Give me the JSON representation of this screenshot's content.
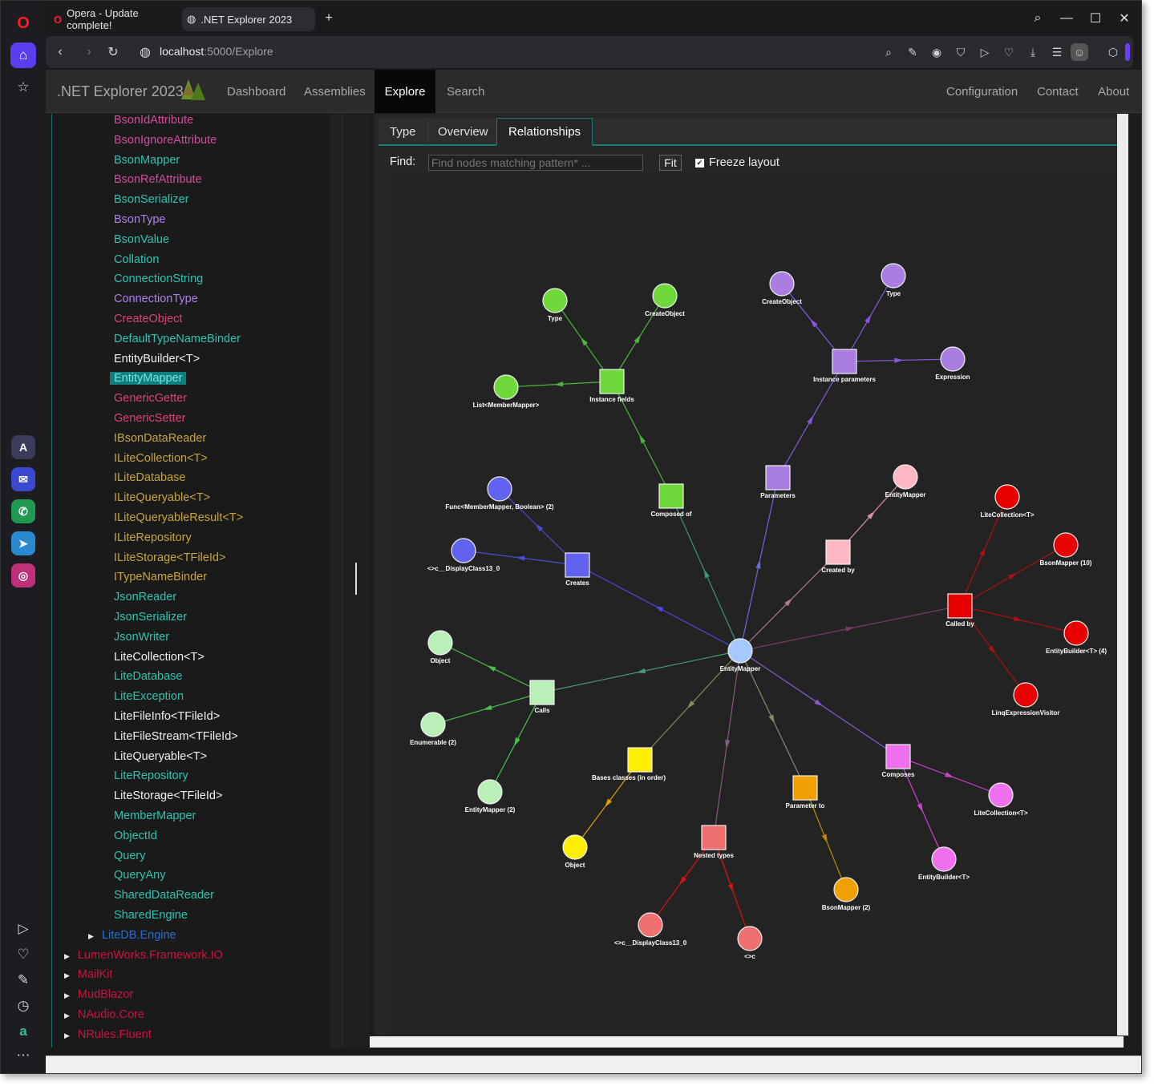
{
  "browser": {
    "tabs": [
      {
        "title": "Opera - Update complete!"
      },
      {
        "title": ".NET Explorer 2023"
      }
    ],
    "url_host": "localhost",
    "url_rest": ":5000/Explore"
  },
  "app": {
    "brand": ".NET Explorer 2023",
    "nav": [
      "Dashboard",
      "Assemblies",
      "Explore",
      "Search"
    ],
    "nav_right": [
      "Configuration",
      "Contact",
      "About"
    ],
    "active_nav": "Explore"
  },
  "tree": {
    "items": [
      {
        "label": "BsonIdAttribute",
        "color": "#d64aa0"
      },
      {
        "label": "BsonIgnoreAttribute",
        "color": "#d64aa0"
      },
      {
        "label": "BsonMapper",
        "color": "#2cc4b0"
      },
      {
        "label": "BsonRefAttribute",
        "color": "#d64aa0"
      },
      {
        "label": "BsonSerializer",
        "color": "#2cc4b0"
      },
      {
        "label": "BsonType",
        "color": "#b07ff0"
      },
      {
        "label": "BsonValue",
        "color": "#2cc4b0"
      },
      {
        "label": "Collation",
        "color": "#2cc4b0"
      },
      {
        "label": "ConnectionString",
        "color": "#2cc4b0"
      },
      {
        "label": "ConnectionType",
        "color": "#b07ff0"
      },
      {
        "label": "CreateObject",
        "color": "#e0407a"
      },
      {
        "label": "DefaultTypeNameBinder",
        "color": "#2cc4b0"
      },
      {
        "label": "EntityBuilder<T>",
        "color": "#f0f0f0"
      },
      {
        "label": "EntityMapper",
        "color": "#7fe0e0"
      },
      {
        "label": "GenericGetter",
        "color": "#e0407a"
      },
      {
        "label": "GenericSetter",
        "color": "#e0407a"
      },
      {
        "label": "IBsonDataReader",
        "color": "#c8a43a"
      },
      {
        "label": "ILiteCollection<T>",
        "color": "#c8a43a"
      },
      {
        "label": "ILiteDatabase",
        "color": "#c8a43a"
      },
      {
        "label": "ILiteQueryable<T>",
        "color": "#c8a43a"
      },
      {
        "label": "ILiteQueryableResult<T>",
        "color": "#c8a43a"
      },
      {
        "label": "ILiteRepository",
        "color": "#c8a43a"
      },
      {
        "label": "ILiteStorage<TFileId>",
        "color": "#c8a43a"
      },
      {
        "label": "ITypeNameBinder",
        "color": "#c8a43a"
      },
      {
        "label": "JsonReader",
        "color": "#2cc4b0"
      },
      {
        "label": "JsonSerializer",
        "color": "#2cc4b0"
      },
      {
        "label": "JsonWriter",
        "color": "#2cc4b0"
      },
      {
        "label": "LiteCollection<T>",
        "color": "#f0f0f0"
      },
      {
        "label": "LiteDatabase",
        "color": "#2cc4b0"
      },
      {
        "label": "LiteException",
        "color": "#2cc4b0"
      },
      {
        "label": "LiteFileInfo<TFileId>",
        "color": "#f0f0f0"
      },
      {
        "label": "LiteFileStream<TFileId>",
        "color": "#f0f0f0"
      },
      {
        "label": "LiteQueryable<T>",
        "color": "#f0f0f0"
      },
      {
        "label": "LiteRepository",
        "color": "#2cc4b0"
      },
      {
        "label": "LiteStorage<TFileId>",
        "color": "#f0f0f0"
      },
      {
        "label": "MemberMapper",
        "color": "#2cc4b0"
      },
      {
        "label": "ObjectId",
        "color": "#2cc4b0"
      },
      {
        "label": "Query",
        "color": "#2cc4b0"
      },
      {
        "label": "QueryAny",
        "color": "#2cc4b0"
      },
      {
        "label": "SharedDataReader",
        "color": "#2cc4b0"
      },
      {
        "label": "SharedEngine",
        "color": "#2cc4b0"
      }
    ],
    "selected": "EntityMapper",
    "namespace": {
      "label": "LiteDB.Engine",
      "color": "#2a6fd0"
    },
    "assemblies": [
      {
        "label": "LumenWorks.Framework.IO",
        "color": "#c8143c"
      },
      {
        "label": "MailKit",
        "color": "#c8143c"
      },
      {
        "label": "MudBlazor",
        "color": "#c8143c"
      },
      {
        "label": "NAudio.Core",
        "color": "#c8143c"
      },
      {
        "label": "NRules.Fluent",
        "color": "#c8143c"
      }
    ]
  },
  "content": {
    "tabs": [
      "Type",
      "Overview",
      "Relationships"
    ],
    "active_tab": "Relationships",
    "find_label": "Find:",
    "find_placeholder": "Find nodes matching pattern* ...",
    "fit_label": "Fit",
    "freeze_label": "Freeze layout",
    "freeze_checked": true
  },
  "graph": {
    "nodes": [
      {
        "id": "center",
        "label": "EntityMapper",
        "shape": "circle",
        "color": "#a4c8ff"
      },
      {
        "id": "composed",
        "label": "Composed of",
        "shape": "square",
        "color": "#6fd83a"
      },
      {
        "id": "instfields",
        "label": "Instance fields",
        "shape": "square",
        "color": "#6fd83a"
      },
      {
        "id": "g_type",
        "label": "Type",
        "shape": "circle",
        "color": "#6fd83a"
      },
      {
        "id": "g_create",
        "label": "CreateObject",
        "shape": "circle",
        "color": "#6fd83a"
      },
      {
        "id": "g_list",
        "label": "List<MemberMapper>",
        "shape": "circle",
        "color": "#6fd83a"
      },
      {
        "id": "params",
        "label": "Parameters",
        "shape": "square",
        "color": "#a97ee0"
      },
      {
        "id": "instparams",
        "label": "Instance parameters",
        "shape": "square",
        "color": "#a97ee0"
      },
      {
        "id": "p_create",
        "label": "CreateObject",
        "shape": "circle",
        "color": "#a97ee0"
      },
      {
        "id": "p_type",
        "label": "Type",
        "shape": "circle",
        "color": "#a97ee0"
      },
      {
        "id": "p_expr",
        "label": "Expression",
        "shape": "circle",
        "color": "#a97ee0"
      },
      {
        "id": "creates",
        "label": "Creates",
        "shape": "square",
        "color": "#6262f0"
      },
      {
        "id": "c_func",
        "label": "Func<MemberMapper, Boolean> (2)",
        "shape": "circle",
        "color": "#6262f0"
      },
      {
        "id": "c_disp",
        "label": "<>c__DisplayClass13_0",
        "shape": "circle",
        "color": "#6262f0"
      },
      {
        "id": "createdby",
        "label": "Created by",
        "shape": "square",
        "color": "#ffb8c4"
      },
      {
        "id": "cb_em",
        "label": "EntityMapper",
        "shape": "circle",
        "color": "#ffb8c4"
      },
      {
        "id": "calledby",
        "label": "Called by",
        "shape": "square",
        "color": "#e80000"
      },
      {
        "id": "r_lc",
        "label": "LiteCollection<T>",
        "shape": "circle",
        "color": "#e80000"
      },
      {
        "id": "r_bm",
        "label": "BsonMapper (10)",
        "shape": "circle",
        "color": "#e80000"
      },
      {
        "id": "r_eb",
        "label": "EntityBuilder<T> (4)",
        "shape": "circle",
        "color": "#e80000"
      },
      {
        "id": "r_lev",
        "label": "LinqExpressionVisitor",
        "shape": "circle",
        "color": "#e80000"
      },
      {
        "id": "calls",
        "label": "Calls",
        "shape": "square",
        "color": "#b8f0b8"
      },
      {
        "id": "l_obj",
        "label": "Object",
        "shape": "circle",
        "color": "#b8f0b8"
      },
      {
        "id": "l_enum",
        "label": "Enumerable (2)",
        "shape": "circle",
        "color": "#b8f0b8"
      },
      {
        "id": "l_em",
        "label": "EntityMapper (2)",
        "shape": "circle",
        "color": "#b8f0b8"
      },
      {
        "id": "bases",
        "label": "Bases classes (in order)",
        "shape": "square",
        "color": "#ffee00"
      },
      {
        "id": "y_obj",
        "label": "Object",
        "shape": "circle",
        "color": "#ffee00"
      },
      {
        "id": "nested",
        "label": "Nested types",
        "shape": "square",
        "color": "#f07070"
      },
      {
        "id": "n_disp",
        "label": "<>c__DisplayClass13_0",
        "shape": "circle",
        "color": "#f07070"
      },
      {
        "id": "n_c",
        "label": "<>c",
        "shape": "circle",
        "color": "#f07070"
      },
      {
        "id": "paramto",
        "label": "Parameter to",
        "shape": "square",
        "color": "#f0a000"
      },
      {
        "id": "o_bm",
        "label": "BsonMapper (2)",
        "shape": "circle",
        "color": "#f0a000"
      },
      {
        "id": "composes",
        "label": "Composes",
        "shape": "square",
        "color": "#ee70ee"
      },
      {
        "id": "m_lc",
        "label": "LiteCollection<T>",
        "shape": "circle",
        "color": "#ee70ee"
      },
      {
        "id": "m_eb",
        "label": "EntityBuilder<T>",
        "shape": "circle",
        "color": "#ee70ee"
      }
    ]
  }
}
